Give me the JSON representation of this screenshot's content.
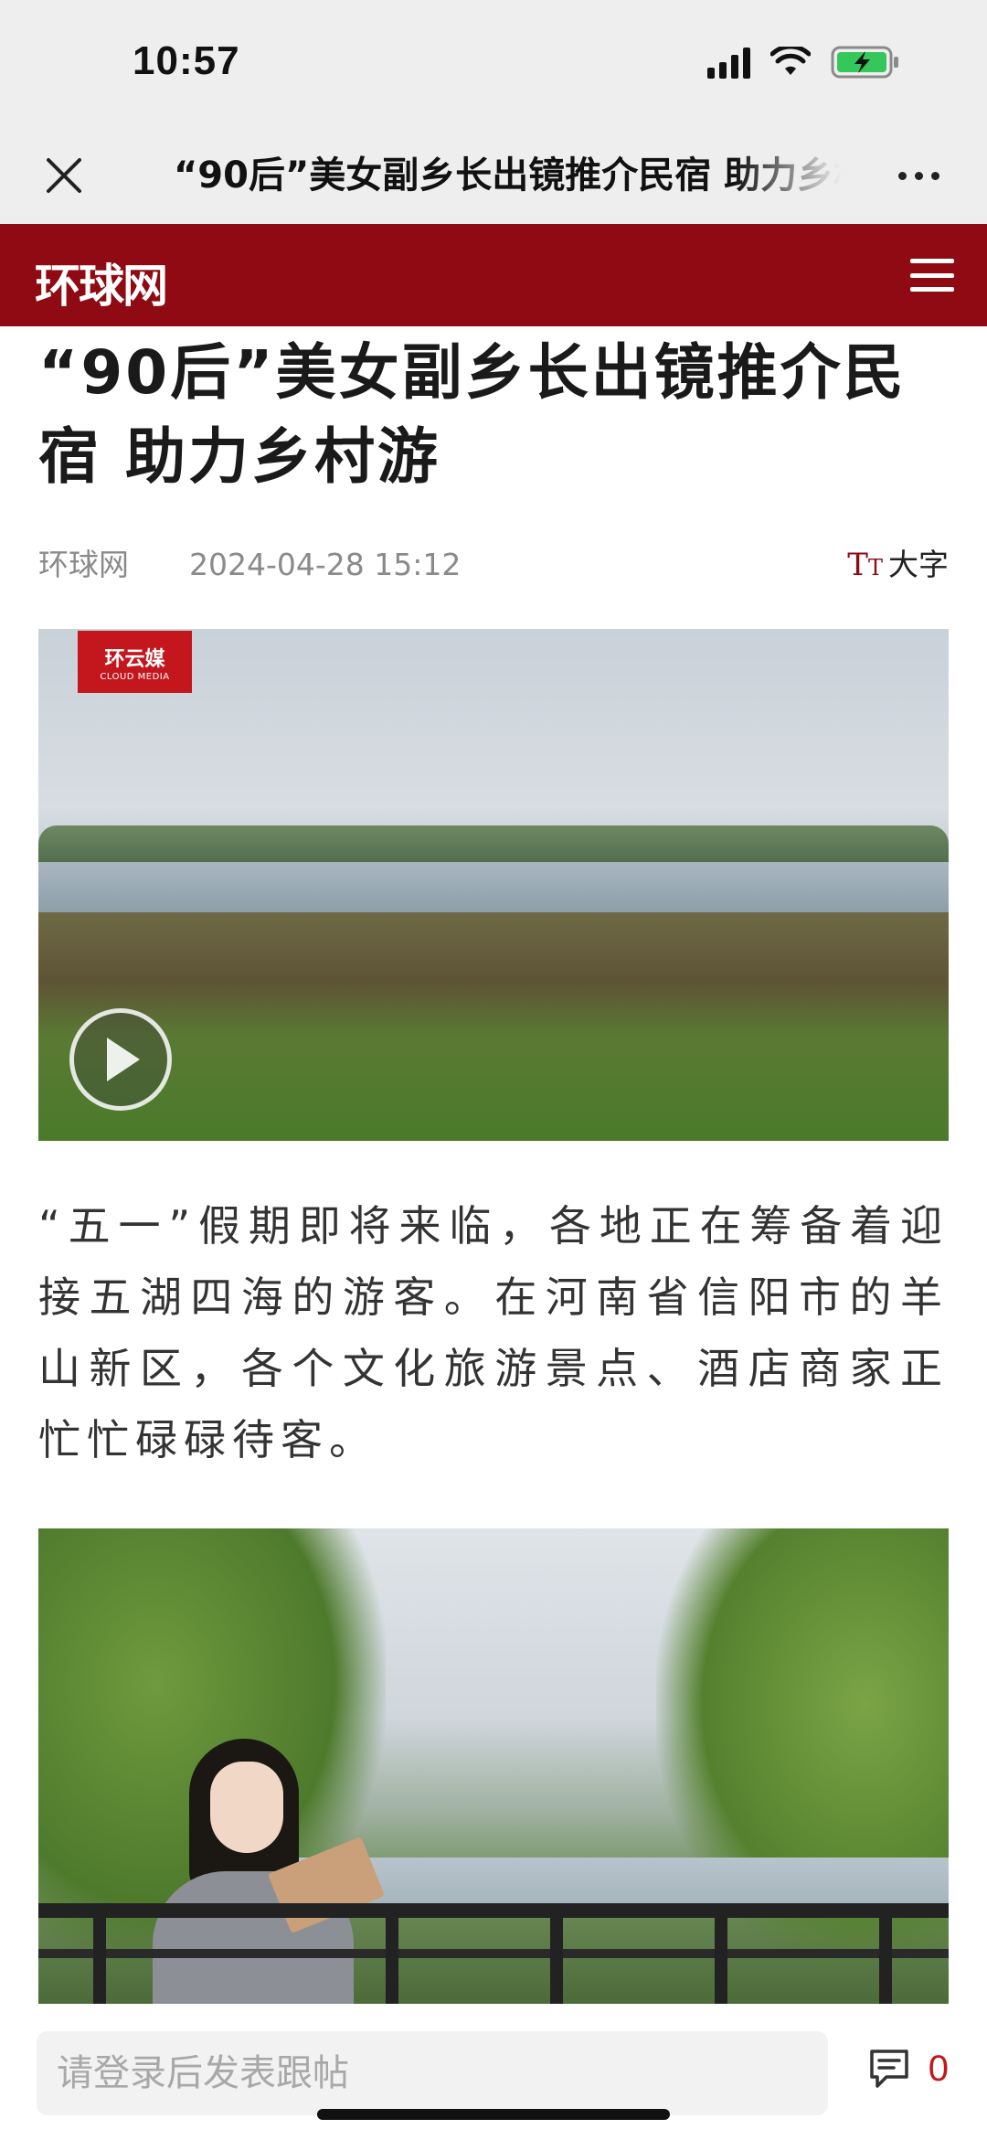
{
  "status_bar": {
    "time": "10:57",
    "icons": [
      "cellular-signal-icon",
      "wifi-icon",
      "battery-charging-icon"
    ],
    "battery_color": "#34c759"
  },
  "nav": {
    "title": "“90后”美女副乡长出镜推介民宿 助力乡村游",
    "close_icon": "close-icon",
    "more_icon": "more-dots-icon"
  },
  "site": {
    "logo": "环球网",
    "brand_color": "#8f0a12",
    "menu_icon": "hamburger-menu-icon"
  },
  "article": {
    "title": "“90后”美女副乡长出镜推介民宿 助力乡村游",
    "source": "环球网",
    "date": "2024-04-28 15:12",
    "font_size_label": "大字",
    "font_size_icon": "Tт",
    "video": {
      "badge_main": "环云媒",
      "badge_sub": "CLOUD MEDIA",
      "play_icon": "play-icon"
    },
    "paragraph": "“五一”假期即将来临，各地正在筹备着迎接五湖四海的游客。在河南省信阳市的羊山新区，各个文化旅游景点、酒店商家正忙忙碌碌待客。"
  },
  "comment_bar": {
    "placeholder": "请登录后发表跟帖",
    "count": "0",
    "comment_icon": "comment-icon",
    "accent_color": "#c3161d"
  }
}
